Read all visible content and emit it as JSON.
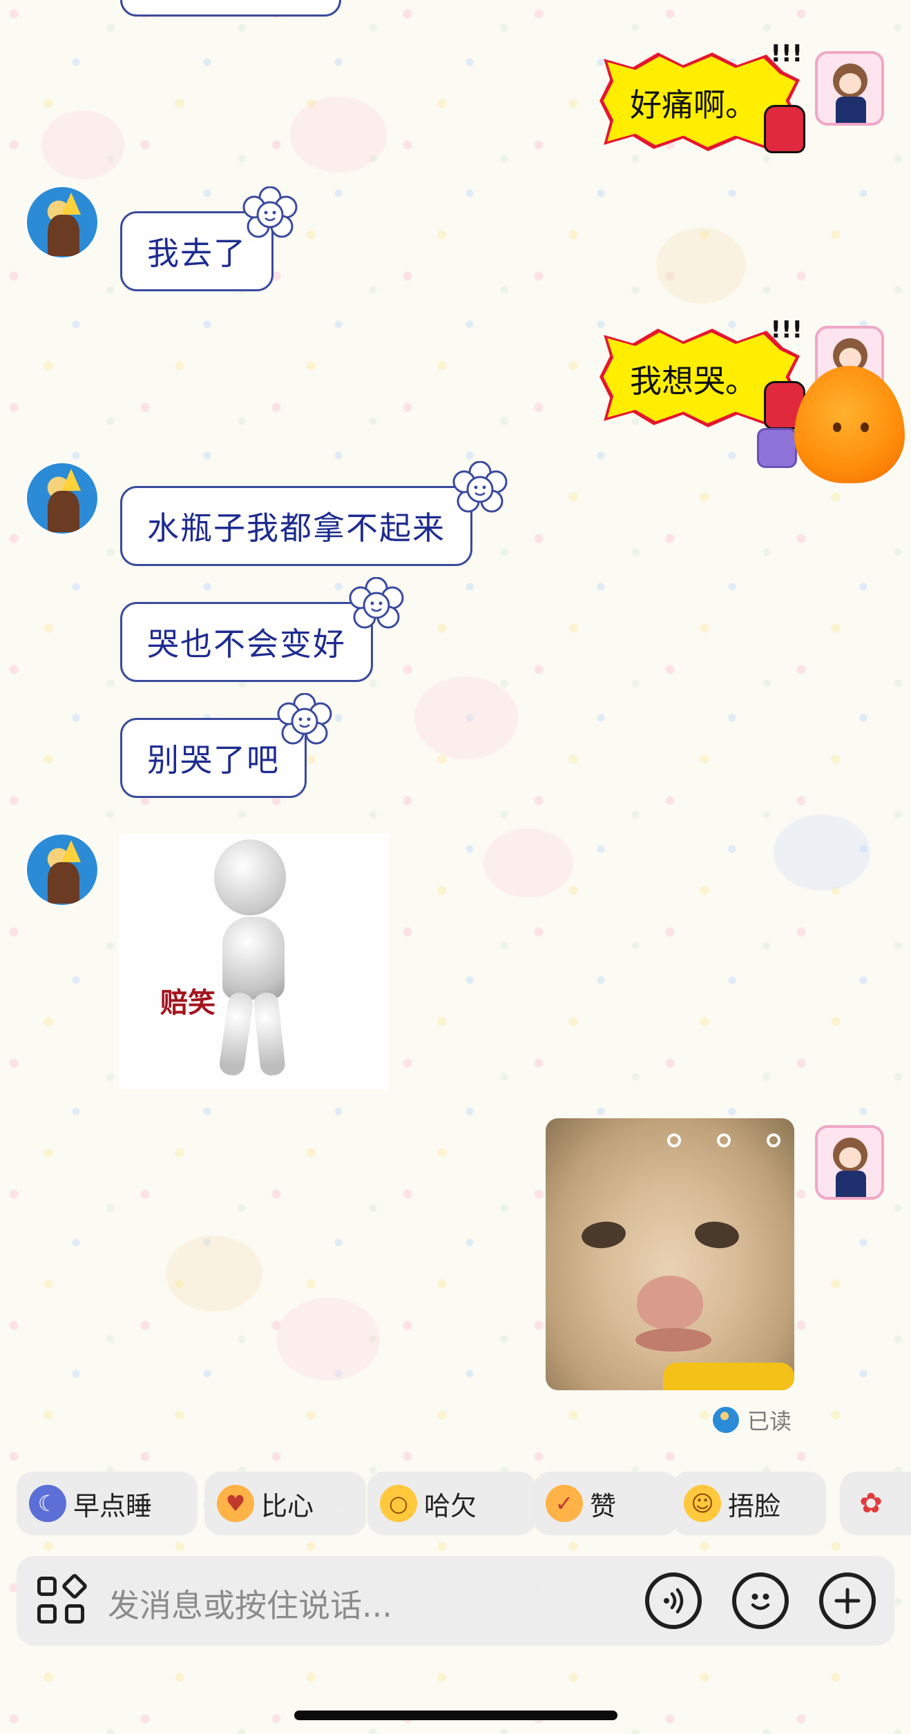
{
  "messages": {
    "right_1": "好痛啊。",
    "left_1": "我去了",
    "right_2": "我想哭。",
    "left_2": "水瓶子我都拿不起来",
    "left_3": "哭也不会变好",
    "left_4": "别哭了吧",
    "sticker_caption": "赔笑",
    "burst_marks": "!!!"
  },
  "read_status": "已读",
  "quick_replies": [
    {
      "label": "早点睡",
      "icon": "moon-emoji",
      "color": "#5b6fd6"
    },
    {
      "label": "比心",
      "icon": "heart-hands-emoji",
      "color": "#ffb347"
    },
    {
      "label": "哈欠",
      "icon": "yawn-emoji",
      "color": "#ffc83d"
    },
    {
      "label": "赞",
      "icon": "thumbs-up-emoji",
      "color": "#ffb347"
    },
    {
      "label": "捂脸",
      "icon": "facepalm-emoji",
      "color": "#ffc83d"
    },
    {
      "label": "",
      "icon": "rose-emoji",
      "color": "#e23b3b"
    }
  ],
  "input": {
    "placeholder": "发消息或按住说话..."
  },
  "colors": {
    "left_bubble_text": "#1d2b8f",
    "burst_fill": "#ffee00",
    "burst_outline": "#e5162f"
  }
}
